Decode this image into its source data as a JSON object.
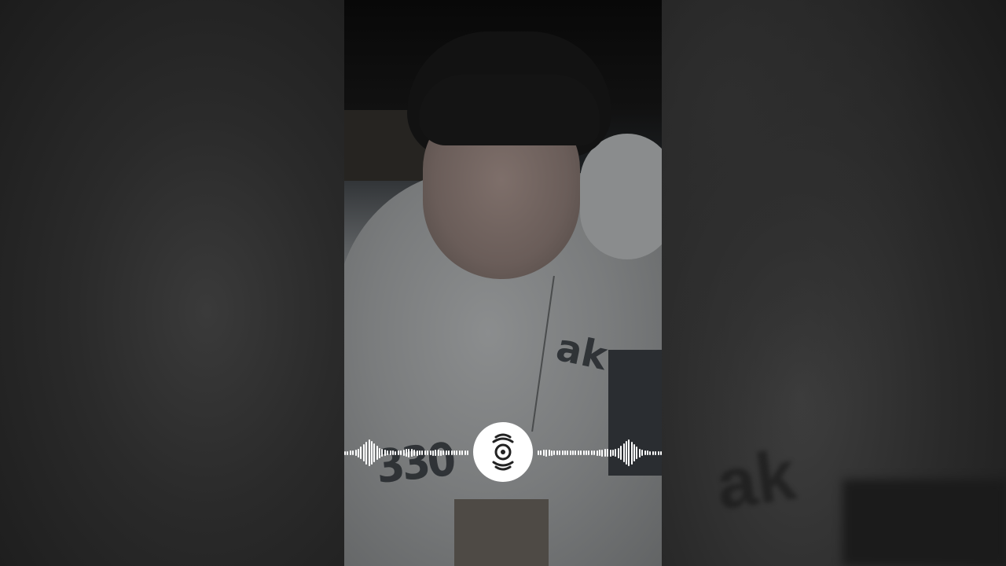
{
  "player": {
    "layout": "vertical-video-pillarboxed",
    "overlay": "audio-visualizer",
    "center_icon": "vinyl-disc-icon"
  },
  "visualizer": {
    "color": "#ffffff",
    "center_badge_color": "#ffffff",
    "left_levels": [
      0.06,
      0.06,
      0.07,
      0.08,
      0.1,
      0.14,
      0.2,
      0.28,
      0.36,
      0.42,
      0.38,
      0.3,
      0.22,
      0.16,
      0.12,
      0.1,
      0.08,
      0.07,
      0.07,
      0.06,
      0.07,
      0.08,
      0.1,
      0.12,
      0.14,
      0.12,
      0.1,
      0.09,
      0.08,
      0.08,
      0.07,
      0.07,
      0.08,
      0.09,
      0.1,
      0.1,
      0.09,
      0.08,
      0.08,
      0.07,
      0.07,
      0.07,
      0.08,
      0.08,
      0.08,
      0.08,
      0.07
    ],
    "right_levels": [
      0.07,
      0.08,
      0.1,
      0.11,
      0.1,
      0.09,
      0.08,
      0.08,
      0.07,
      0.07,
      0.08,
      0.08,
      0.08,
      0.08,
      0.07,
      0.07,
      0.07,
      0.08,
      0.08,
      0.08,
      0.08,
      0.08,
      0.09,
      0.1,
      0.11,
      0.12,
      0.12,
      0.11,
      0.1,
      0.12,
      0.16,
      0.22,
      0.3,
      0.38,
      0.42,
      0.36,
      0.28,
      0.2,
      0.14,
      0.1,
      0.08,
      0.07,
      0.06,
      0.06,
      0.06,
      0.06,
      0.06
    ]
  },
  "video_frame": {
    "shirt_print_number": "330",
    "shirt_print_word": "ak"
  },
  "side_panels": {
    "ghost_text": "ak"
  }
}
